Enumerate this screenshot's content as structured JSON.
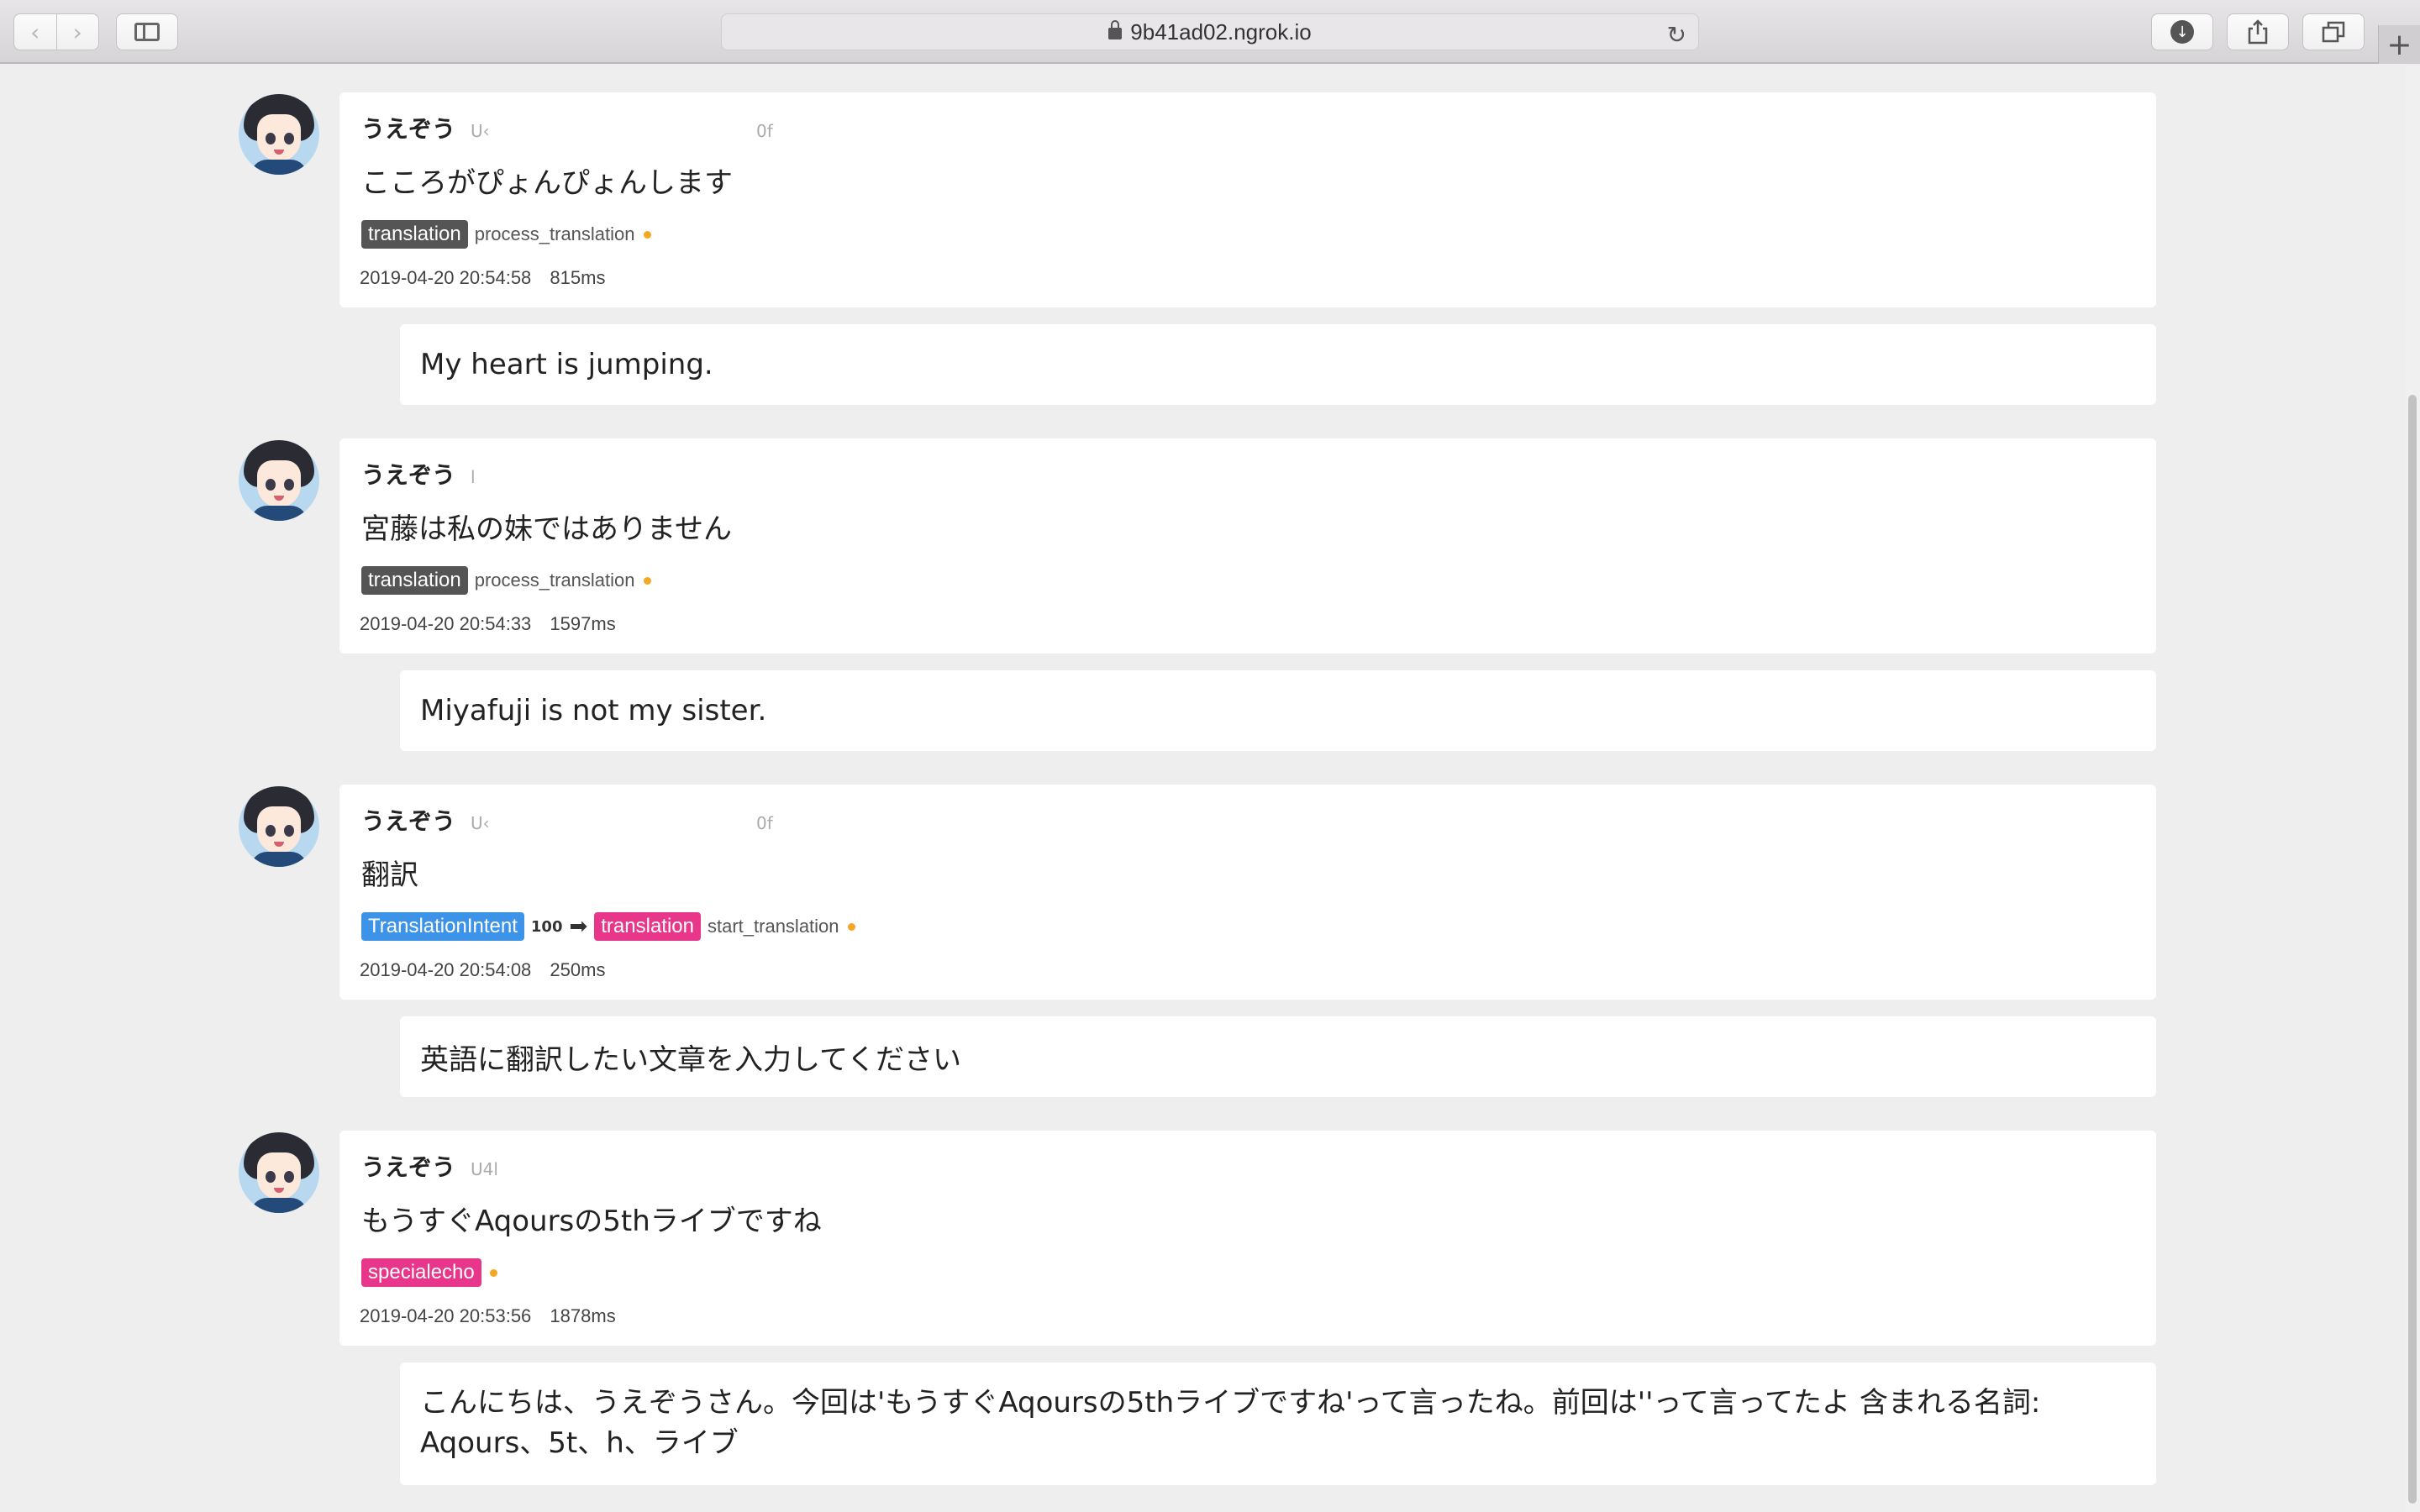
{
  "browser": {
    "url": "9b41ad02.ngrok.io",
    "back_icon": "‹",
    "forward_icon": "›",
    "new_tab_icon": "+"
  },
  "entries": [
    {
      "user_name": "うえぞう",
      "user_id_prefix": "U‹",
      "user_id_suffix": "0f",
      "message": "こころがぴょんぴょんします",
      "intent": "",
      "score": "",
      "action_tag": "translation",
      "handler": "process_translation",
      "timestamp": "2019-04-20 20:54:58",
      "duration": "815ms",
      "reply": "My heart is jumping."
    },
    {
      "user_name": "うえぞう",
      "user_id_prefix": "l",
      "user_id_suffix": "",
      "message": "宮藤は私の妹ではありません",
      "intent": "",
      "score": "",
      "action_tag": "translation",
      "handler": "process_translation",
      "timestamp": "2019-04-20 20:54:33",
      "duration": "1597ms",
      "reply": "Miyafuji is not my sister."
    },
    {
      "user_name": "うえぞう",
      "user_id_prefix": "U‹",
      "user_id_suffix": "0f",
      "message": "翻訳",
      "intent": "TranslationIntent",
      "score": "100",
      "action_tag": "translation",
      "handler": "start_translation",
      "timestamp": "2019-04-20 20:54:08",
      "duration": "250ms",
      "reply": "英語に翻訳したい文章を入力してください"
    },
    {
      "user_name": "うえぞう",
      "user_id_prefix": "U4l",
      "user_id_suffix": "",
      "message": "もうすぐAqoursの5thライブですね",
      "intent": "",
      "score": "",
      "action_tag": "specialecho",
      "handler": "",
      "timestamp": "2019-04-20 20:53:56",
      "duration": "1878ms",
      "reply": "こんにちは、うえぞうさん。今回は'もうすぐAqoursの5thライブですね'って言ったね。前回は''って言ってたよ 含まれる名詞: Aqours、5t、h、ライブ"
    }
  ],
  "colors": {
    "tag_gray": "#555555",
    "tag_blue": "#3d93e8",
    "tag_pink": "#e8378a",
    "status_dot": "#f5a623",
    "page_bg": "#eeeeee"
  }
}
